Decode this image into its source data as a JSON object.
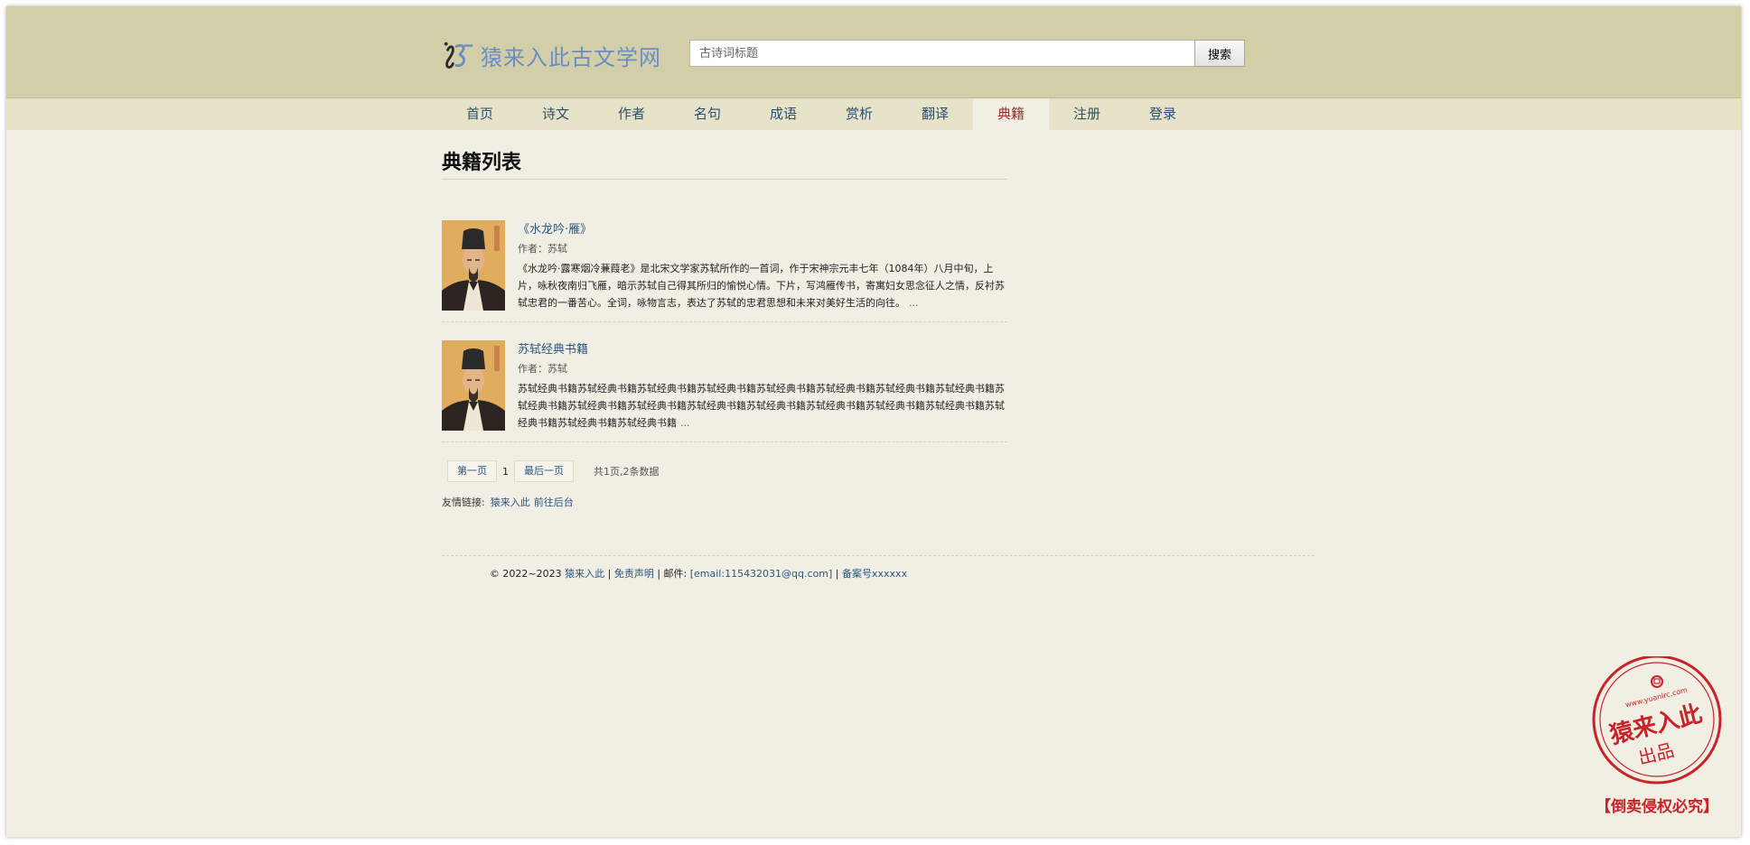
{
  "site": {
    "logo_text": "猿来入此古文学网"
  },
  "search": {
    "placeholder": "古诗词标题",
    "button_label": "搜索"
  },
  "nav": {
    "items": [
      {
        "label": "首页"
      },
      {
        "label": "诗文"
      },
      {
        "label": "作者"
      },
      {
        "label": "名句"
      },
      {
        "label": "成语"
      },
      {
        "label": "赏析"
      },
      {
        "label": "翻译"
      },
      {
        "label": "典籍",
        "active": true
      },
      {
        "label": "注册"
      },
      {
        "label": "登录"
      }
    ]
  },
  "page": {
    "title": "典籍列表"
  },
  "books": [
    {
      "title": "《水龙吟·雁》",
      "author": "作者：苏轼",
      "description": "《水龙吟·露寒烟冷蒹葭老》是北宋文学家苏轼所作的一首词，作于宋神宗元丰七年（1084年）八月中旬，上片，咏秋夜南归飞雁，暗示苏轼自己得其所归的愉悦心情。下片，写鸿雁传书，寄寓妇女思念征人之情，反衬苏轼忠君的一番苦心。全词，咏物言志，表达了苏轼的忠君思想和未来对美好生活的向往。",
      "more": "..."
    },
    {
      "title": "苏轼经典书籍",
      "author": "作者：苏轼",
      "description": "苏轼经典书籍苏轼经典书籍苏轼经典书籍苏轼经典书籍苏轼经典书籍苏轼经典书籍苏轼经典书籍苏轼经典书籍苏轼经典书籍苏轼经典书籍苏轼经典书籍苏轼经典书籍苏轼经典书籍苏轼经典书籍苏轼经典书籍苏轼经典书籍苏轼经典书籍苏轼经典书籍苏轼经典书籍",
      "more": "..."
    }
  ],
  "pager": {
    "first_label": "第一页",
    "current": "1",
    "last_label": "最后一页",
    "info": "共1页,2条数据"
  },
  "friend_links": {
    "label": "友情链接:",
    "links": [
      "猿来入此",
      "前往后台"
    ]
  },
  "footer": {
    "copyright": "© 2022~2023 ",
    "site_link": "猿来入此",
    "sep1": " | ",
    "disclaimer": "免责声明",
    "sep2": " | 邮件: ",
    "email": "[email:115432031@qq.com]",
    "sep3": " | ",
    "icp": "备案号xxxxxx"
  },
  "seal": {
    "url_text": "www.yuanlrc.com",
    "main_text": "猿来入此",
    "sub_text": "出品",
    "banner_text": "【倒卖侵权必究】",
    "color": "#c8232b"
  }
}
